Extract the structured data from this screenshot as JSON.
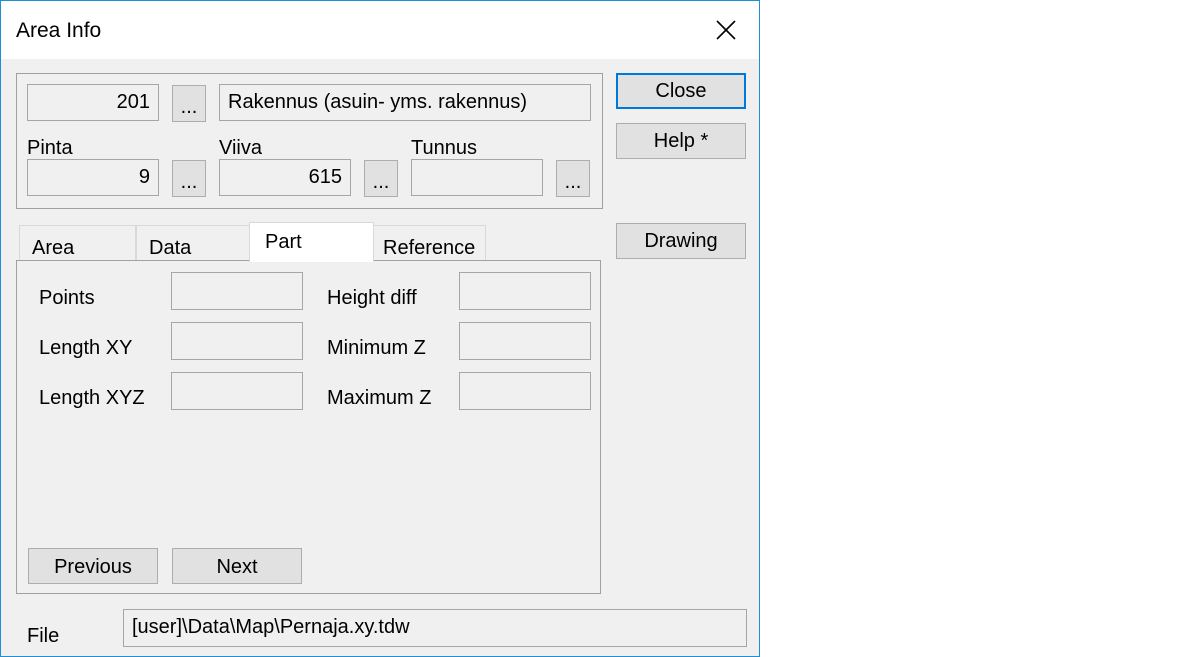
{
  "window": {
    "title": "Area Info"
  },
  "header": {
    "code": "201",
    "description": "Rakennus (asuin- yms. rakennus)",
    "pinta_label": "Pinta",
    "pinta_value": "9",
    "viiva_label": "Viiva",
    "viiva_value": "615",
    "tunnus_label": "Tunnus",
    "tunnus_value": "",
    "dots": "..."
  },
  "buttons": {
    "close": "Close",
    "help": "Help *",
    "drawing": "Drawing",
    "previous": "Previous",
    "next": "Next"
  },
  "tabs": [
    {
      "label": "Area"
    },
    {
      "label": "Data"
    },
    {
      "label": "Part",
      "active": true
    },
    {
      "label": "Reference"
    }
  ],
  "part": {
    "points_label": "Points",
    "points_value": "",
    "length_xy_label": "Length XY",
    "length_xy_value": "",
    "length_xyz_label": "Length XYZ",
    "length_xyz_value": "",
    "height_diff_label": "Height diff",
    "height_diff_value": "",
    "min_z_label": "Minimum Z",
    "min_z_value": "",
    "max_z_label": "Maximum Z",
    "max_z_value": ""
  },
  "file": {
    "label": "File",
    "path": "[user]\\Data\\Map\\Pernaja.xy.tdw"
  }
}
